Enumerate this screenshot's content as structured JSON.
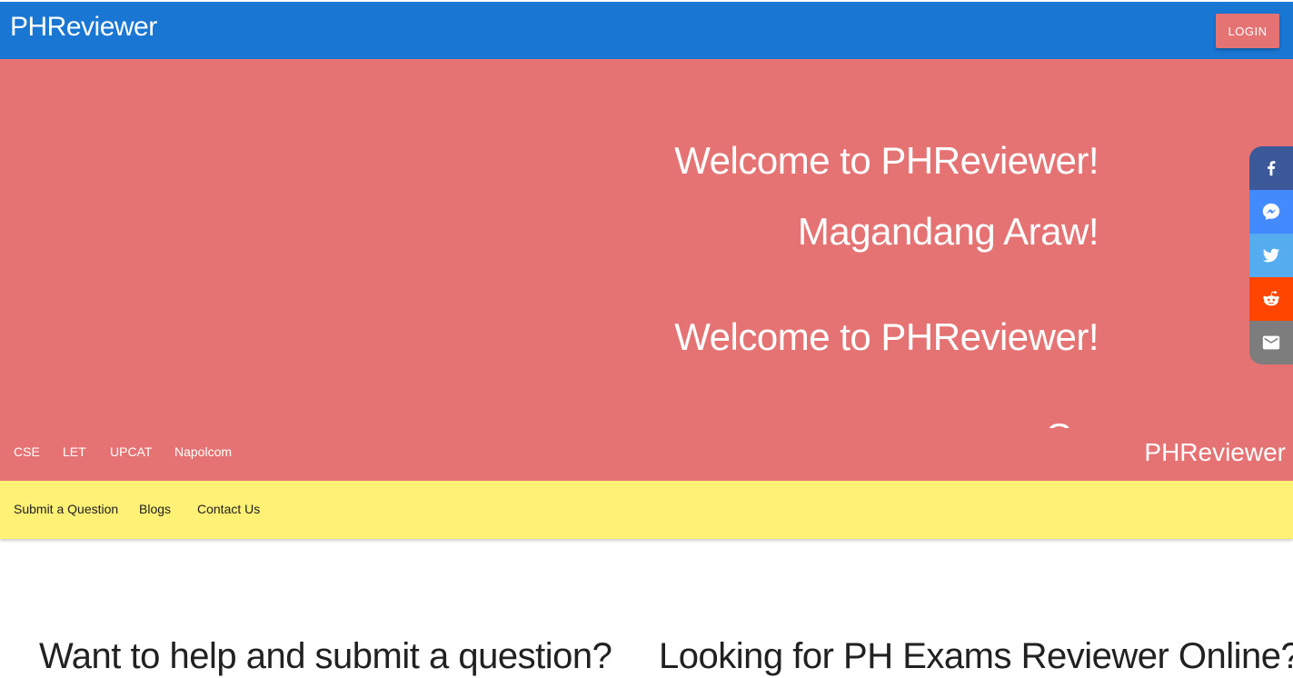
{
  "header": {
    "brand": "PHReviewer",
    "login_label": "LOGIN"
  },
  "hero": {
    "lines": [
      "Welcome to PHReviewer!",
      "Magandang Araw!",
      "Welcome to PHReviewer!"
    ]
  },
  "exam_nav": {
    "items": [
      "CSE",
      "LET",
      "UPCAT",
      "Napolcom"
    ],
    "brand": "PHReviewer"
  },
  "secondary_nav": {
    "items": [
      "Submit a Question",
      "Blogs",
      "Contact Us"
    ]
  },
  "share_bar": {
    "buttons": [
      {
        "icon": "facebook-icon",
        "color": "#3b5998"
      },
      {
        "icon": "messenger-icon",
        "color": "#448aff"
      },
      {
        "icon": "twitter-icon",
        "color": "#55acee"
      },
      {
        "icon": "reddit-icon",
        "color": "#ff4500"
      },
      {
        "icon": "email-icon",
        "color": "#7d7d7d"
      }
    ]
  },
  "content": {
    "left_heading": "Want to help and submit a question?",
    "right_heading": "Looking for PH Exams Reviewer Online?"
  },
  "colors": {
    "header_bg": "#1976d2",
    "hero_bg": "#e57373",
    "secondary_nav_bg": "#fff176"
  }
}
